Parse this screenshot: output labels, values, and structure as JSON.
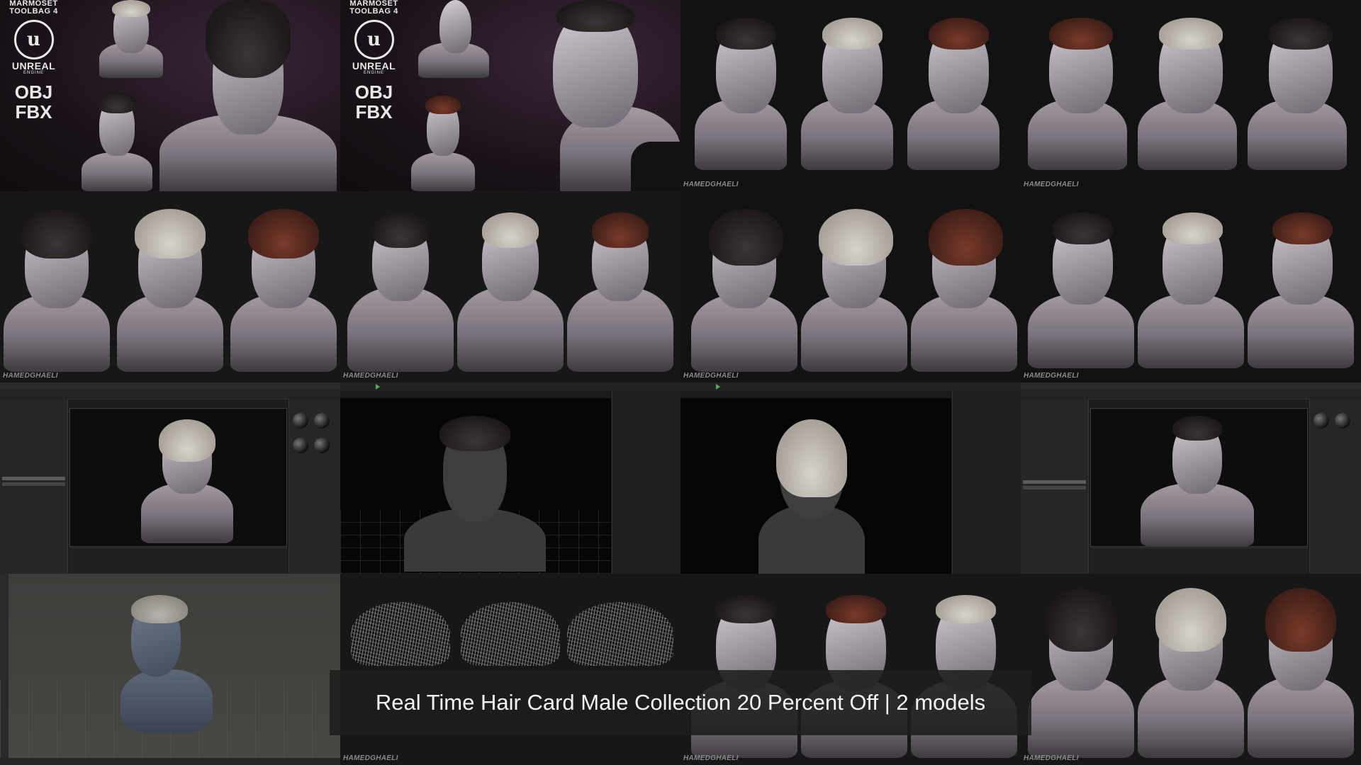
{
  "watermark": "HAMEDGHAELI",
  "logos": {
    "marmoset_line1": "MARMOSET",
    "marmoset_line2": "TOOLBAG 4",
    "ue_glyph": "u",
    "unreal_line1": "UNREAL",
    "unreal_line2": "ENGINE",
    "format_obj": "OBJ",
    "format_fbx": "FBX"
  },
  "caption": "Real Time Hair Card Male Collection 20 Percent Off | 2 models",
  "colors": {
    "background": "#141414",
    "caption_bg": "#1e1e1e",
    "text": "#f2f2f2"
  }
}
